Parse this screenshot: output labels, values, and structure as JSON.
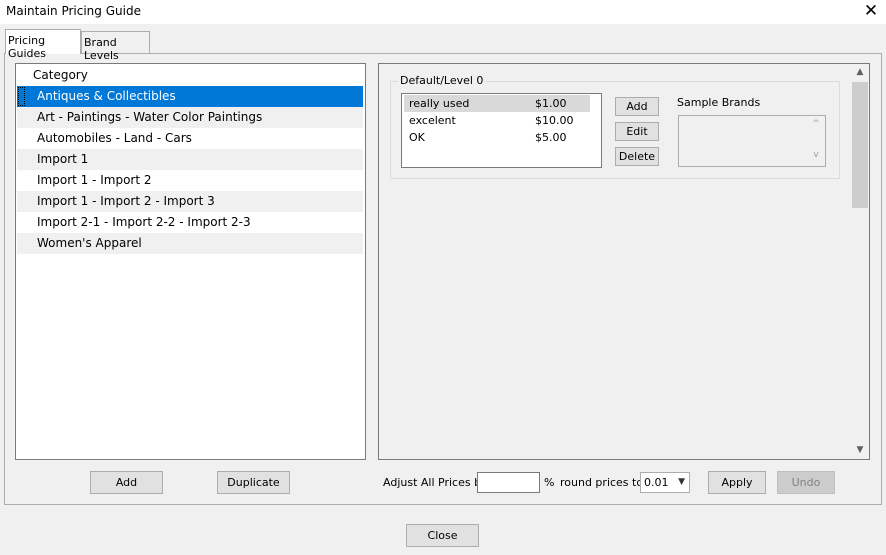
{
  "window": {
    "title": "Maintain Pricing Guide",
    "close_glyph": "✕"
  },
  "tabs": [
    {
      "label": "Pricing Guides",
      "active": true
    },
    {
      "label": "Brand Levels",
      "active": false
    }
  ],
  "category_list": {
    "header": "Category",
    "items": [
      "Antiques & Collectibles",
      "Art - Paintings - Water Color Paintings",
      "Automobiles - Land - Cars",
      "Import 1",
      "Import 1 - Import 2",
      "Import 1 - Import 2 - Import 3",
      "Import 2-1 - Import 2-2 - Import 2-3",
      "Women's Apparel"
    ],
    "selected": "Antiques & Collectibles"
  },
  "left_buttons": {
    "add": "Add",
    "duplicate": "Duplicate"
  },
  "level_group": {
    "title": "Default/Level 0",
    "prices": [
      {
        "name": "really used",
        "price": "$1.00"
      },
      {
        "name": "excelent",
        "price": "$10.00"
      },
      {
        "name": "OK",
        "price": "$5.00"
      }
    ],
    "buttons": {
      "add": "Add",
      "edit": "Edit",
      "delete": "Delete"
    },
    "sample_brands_label": "Sample Brands"
  },
  "adjust": {
    "label": "Adjust All Prices by",
    "percent_value": "",
    "percent_sign": "%",
    "round_label": "round prices to",
    "round_value": "0.01",
    "apply": "Apply",
    "undo": "Undo"
  },
  "footer": {
    "close": "Close"
  },
  "colors": {
    "selection": "#0078d7",
    "background": "#f0f0f0"
  }
}
